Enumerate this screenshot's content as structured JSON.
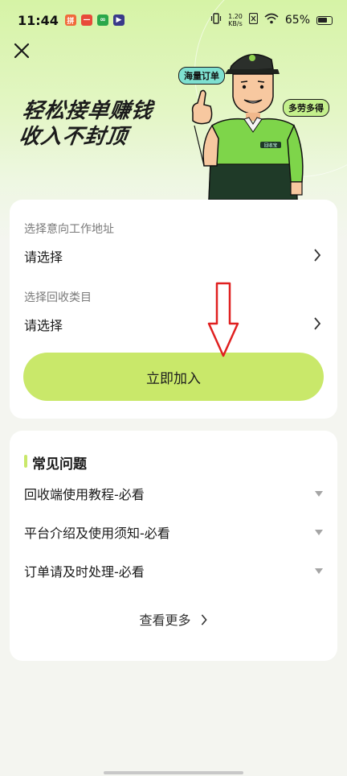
{
  "status_bar": {
    "time": "11:44",
    "net_speed": "1.20",
    "net_unit": "KB/s",
    "battery": "65%"
  },
  "hero": {
    "slogan_line1": "轻松接单赚钱",
    "slogan_line2": "收入不封顶",
    "bubble_orders": "海量订单",
    "bubble_earn": "多劳多得",
    "shirt_logo": "回收宝"
  },
  "form": {
    "address_label": "选择意向工作地址",
    "address_value": "请选择",
    "category_label": "选择回收类目",
    "category_value": "请选择",
    "join_button": "立即加入"
  },
  "faq": {
    "title": "常见问题",
    "items": [
      "回收端使用教程-必看",
      "平台介绍及使用须知-必看",
      "订单请及时处理-必看"
    ],
    "more": "查看更多"
  },
  "colors": {
    "accent": "#c9e86a",
    "hero_bg": "#d6f3a6",
    "annotation_arrow": "#e02020"
  }
}
